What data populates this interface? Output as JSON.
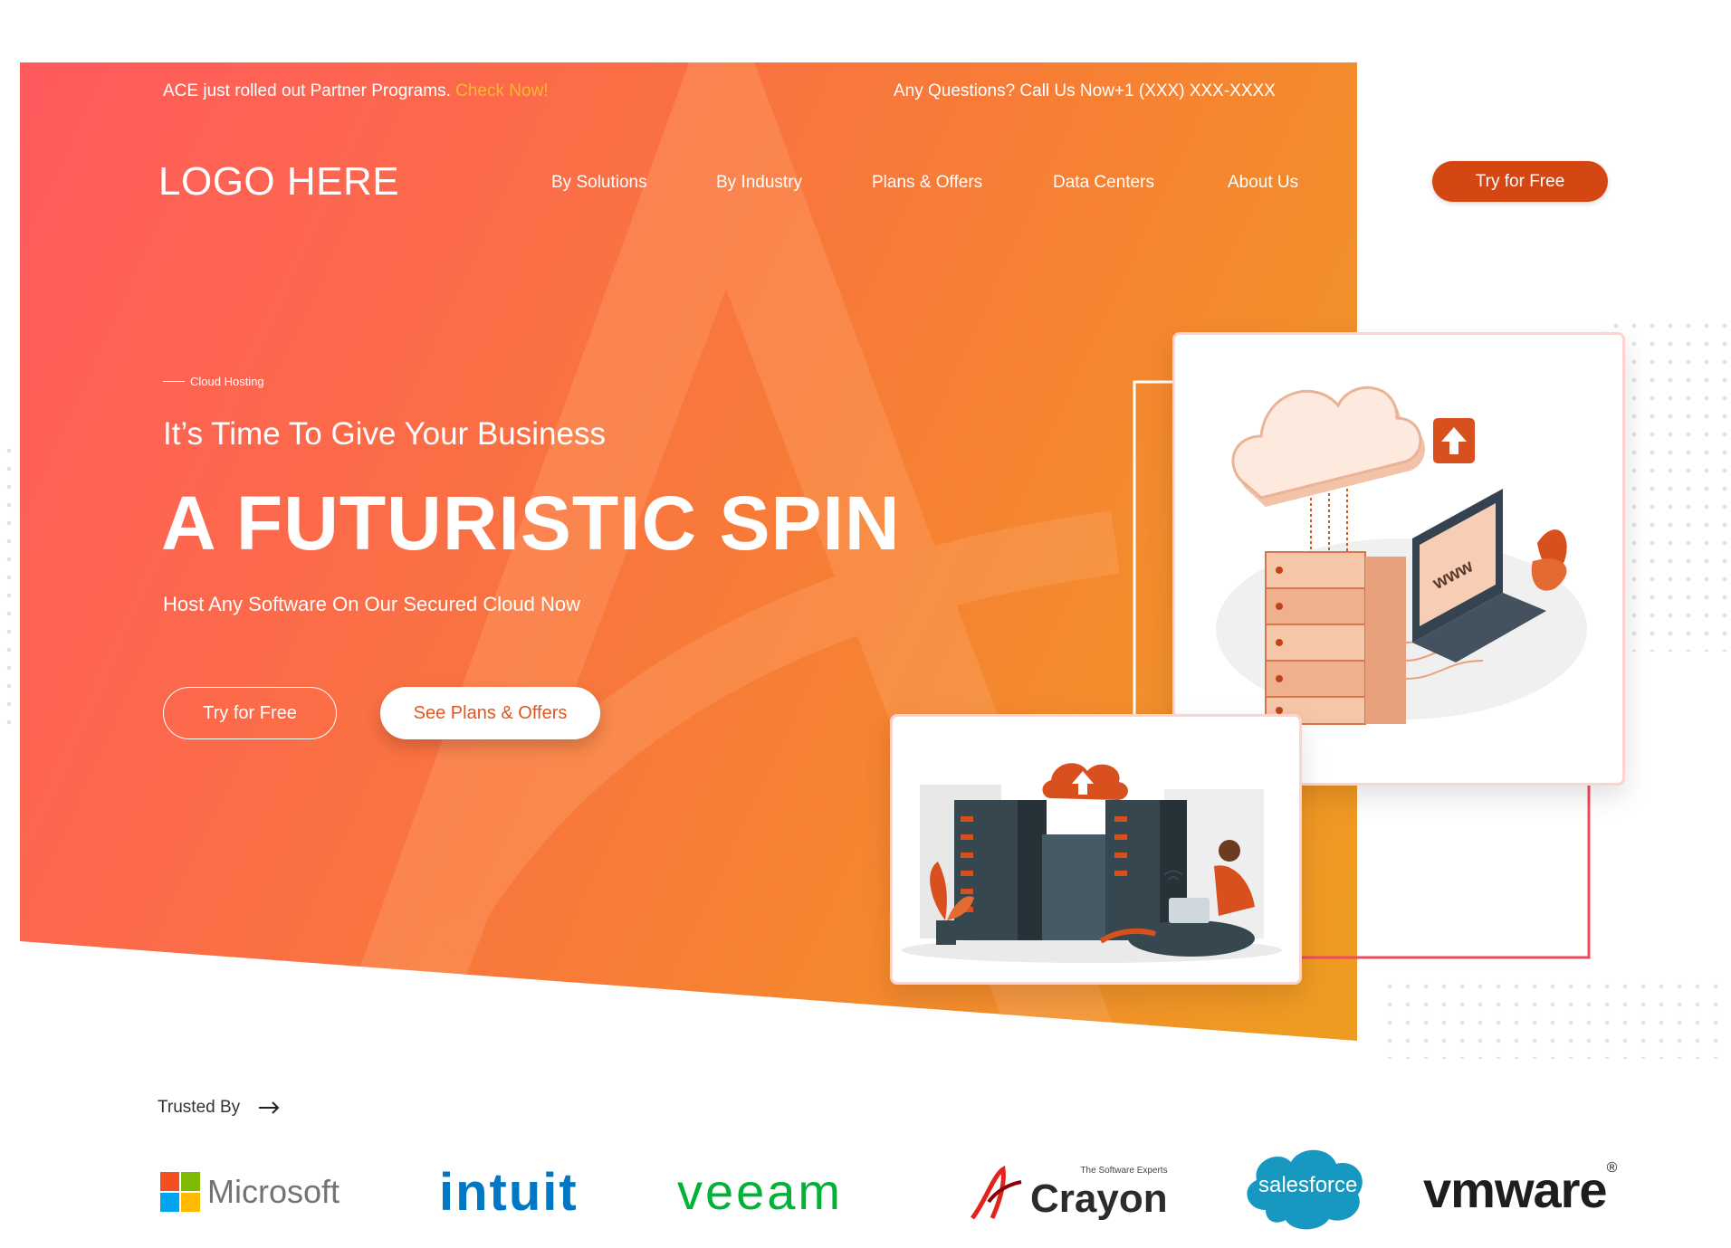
{
  "topbar": {
    "announcement": "ACE just rolled out Partner Programs.",
    "announcement_link": "Check Now!",
    "contact": "Any Questions? Call Us Now+1 (XXX) XXX-XXXX"
  },
  "header": {
    "logo": "LOGO HERE",
    "nav": [
      "By Solutions",
      "By Industry",
      "Plans & Offers",
      "Data Centers",
      "About Us"
    ],
    "cta": "Try for Free"
  },
  "hero": {
    "eyebrow": "Cloud Hosting",
    "subtitle": "It’s Time To Give Your Business",
    "headline": "A FUTURISTIC SPIN",
    "tagline": "Host Any Software On Our Secured Cloud Now",
    "primary_button": "Try for Free",
    "secondary_button": "See Plans & Offers"
  },
  "illustration": {
    "laptop_text": "www"
  },
  "trusted": {
    "label": "Trusted By",
    "logos": [
      "Microsoft",
      "intuit",
      "veeam",
      "Crayon",
      "salesforce",
      "vmware"
    ],
    "crayon_tagline": "The Software Experts"
  },
  "colors": {
    "gradient_start": "#ff5a5f",
    "gradient_end": "#ee9d20",
    "accent_button": "#d54712",
    "link": "#f7b733"
  }
}
